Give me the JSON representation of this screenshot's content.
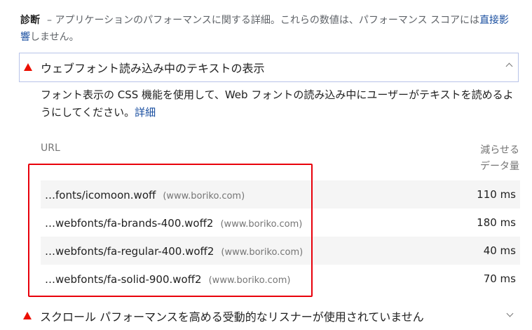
{
  "diagnostics": {
    "label": "診断",
    "description": "– アプリケーションのパフォーマンスに関する詳細。これらの数値は、パフォーマンス スコアには",
    "link_text": "直接影響",
    "suffix": "しません。"
  },
  "open_audit": {
    "title": "ウェブフォント読み込み中のテキストの表示",
    "description": "フォント表示の CSS 機能を使用して、Web フォントの読み込み中にユーザーがテキストを読めるようにしてください。",
    "learn_more": "詳細",
    "table": {
      "col_url": "URL",
      "col_saving_line1": "減らせる",
      "col_saving_line2": "データ量",
      "rows": [
        {
          "url": "…fonts/icomoon.woff",
          "host": "(www.boriko.com)",
          "time": "110 ms"
        },
        {
          "url": "…webfonts/fa-brands-400.woff2",
          "host": "(www.boriko.com)",
          "time": "180 ms"
        },
        {
          "url": "…webfonts/fa-regular-400.woff2",
          "host": "(www.boriko.com)",
          "time": "40 ms"
        },
        {
          "url": "…webfonts/fa-solid-900.woff2",
          "host": "(www.boriko.com)",
          "time": "70 ms"
        }
      ]
    }
  },
  "next_audit": {
    "title": "スクロール パフォーマンスを高める受動的なリスナーが使用されていません"
  },
  "colors": {
    "fail": "#eb0f00",
    "link": "#1a4fa0",
    "highlight": "#e8000b"
  }
}
